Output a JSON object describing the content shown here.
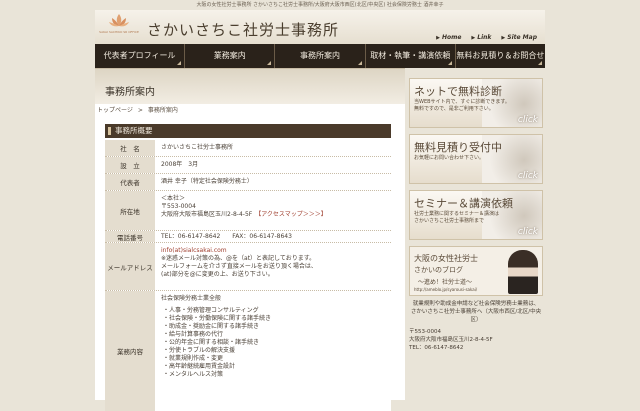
{
  "top_caption": "大阪の女性社労士事務所 さかいさちこ社労士事務所/大阪府大阪市西区(北区/中央区) 社会保険労務士 酒井幸子",
  "header": {
    "logo_en": "SAKAI SACHIKO SR OFFICE",
    "title": "さかいさちこ社労士事務所",
    "links": [
      "Home",
      "Link",
      "Site Map"
    ]
  },
  "nav": [
    "代表者プロフィール",
    "業務案内",
    "事務所案内",
    "取材・執筆・講演依頼",
    "無料お見積り＆お問合せ"
  ],
  "page_heading": "事務所案内",
  "breadcrumb": {
    "home": "トップページ",
    "sep": ">",
    "current": "事務所案内"
  },
  "section_title": "事務所概要",
  "info": {
    "name_label": "社　名",
    "name_value": "さかいさちこ社労士事務所",
    "founded_label": "設　立",
    "founded_value": "2008年　3月",
    "rep_label": "代表者",
    "rep_value": "酒井 幸子（特定社会保険労務士）",
    "addr_label": "所在地",
    "addr_1": "＜本社＞",
    "addr_2": "〒553-0004",
    "addr_3": "大阪府大阪市福島区玉川2-8-4-5F",
    "addr_access": "【アクセスマップ＞＞＞】",
    "tel_label": "電話番号",
    "tel_value": "TEL：06-6147-8642　　FAX：06-6147-8643",
    "mail_label": "メールアドレス",
    "mail_1": "info(at)sialcsakai.com",
    "mail_2": "※迷惑メール対策の為、@を（at）と表記しております。",
    "mail_3": "メールフォームを介さず直接メールをお送り頂く場合は、",
    "mail_4": "(at)部分を@に変更の上、お送り下さい。",
    "biz_label": "業務内容",
    "biz_head": "社会保険労務士業全般",
    "biz_items": [
      "人事・労務管理コンサルティング",
      "社会保険・労働保険に関する諸手続き",
      "助成金・奨励金に関する諸手続き",
      "給与計算事務の代行",
      "公的年金に関する相談・諸手続き",
      "労使トラブルの解決支援",
      "就業規則作成・変更",
      "高年齢継続雇用賃金設計",
      "メンタルヘルス対策"
    ]
  },
  "sidebar": {
    "banner1_title": "ネットで無料診断",
    "banner1_sub1": "当WEBサイト内で、すぐに診断できます。",
    "banner1_sub2": "無料ですので、是非ご利用下さい。",
    "banner2_title": "無料見積り受付中",
    "banner2_sub1": "お気軽にお問い合わせ下さい。",
    "banner3_title": "セミナー＆講演依頼",
    "banner3_sub1": "社労士業務に関するセミナー＆講演は",
    "banner3_sub2": "さかいさちこ社労士事務所まで",
    "click": "click",
    "banner4_title": "大阪の女性社労士",
    "banner4_sub": "さかいのブログ",
    "banner4_sub2": "〜進め！社労士道〜",
    "banner4_url": "http://ameblo.jp/syarousi-sakai/",
    "side_1": "就業規則や助成金申請など社会保険労務士業務は、",
    "side_2": "さかいさちこ社労士事務所へ（大阪市西区/北区/中央区）",
    "side_3": "〒553-0004",
    "side_4": "大阪府大阪市福島区玉川2-8-4-5F",
    "side_5": "TEL：06-6147-8642"
  }
}
